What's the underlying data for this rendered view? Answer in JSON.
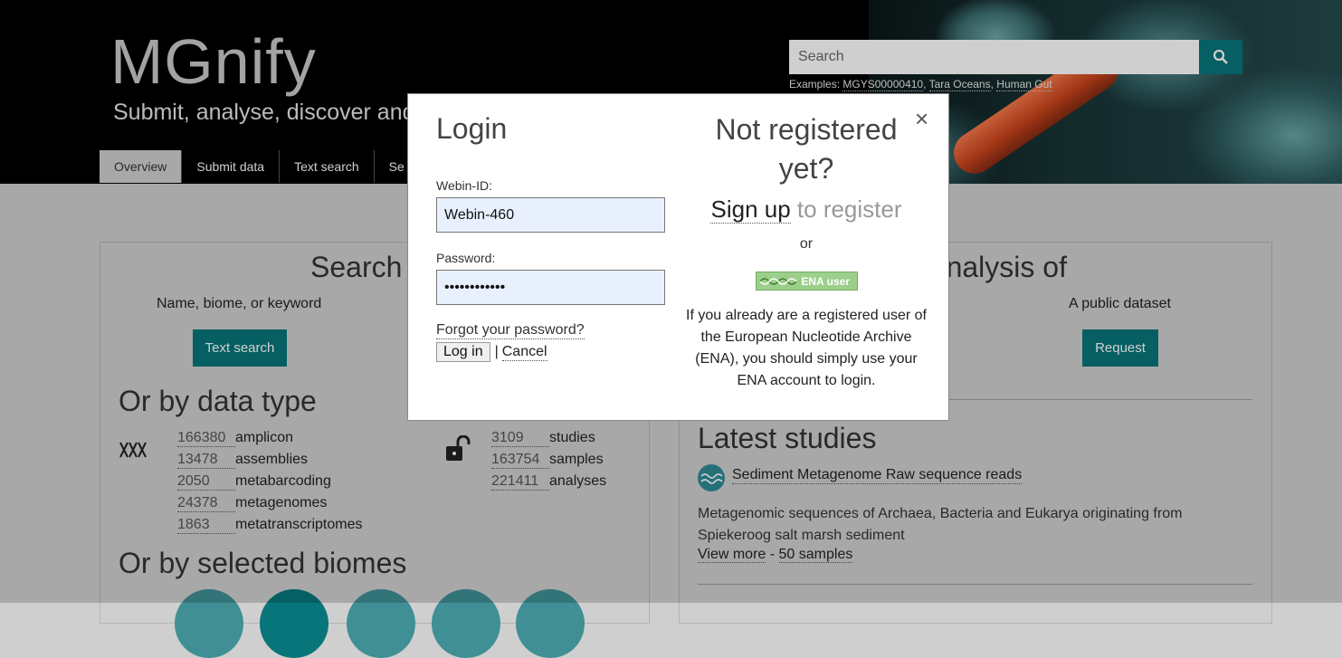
{
  "header": {
    "logo_text": "MGnify",
    "tagline": "Submit, analyse, discover and",
    "search_placeholder": "Search",
    "examples_label": "Examples:",
    "examples": [
      "MGYS00000410",
      "Tara Oceans",
      "Human Gut"
    ],
    "nav": [
      "Overview",
      "Submit data",
      "Text search",
      "Se"
    ]
  },
  "left_panel": {
    "search_heading": "Search",
    "search_sub": "Name, biome, or keyword",
    "text_search_btn": "Text search",
    "by_type_heading": "Or by data type",
    "types": [
      {
        "count": "166380",
        "label": "amplicon"
      },
      {
        "count": "13478",
        "label": "assemblies"
      },
      {
        "count": "2050",
        "label": "metabarcoding"
      },
      {
        "count": "24378",
        "label": "metagenomes"
      },
      {
        "count": "1863",
        "label": "metatranscriptomes"
      }
    ],
    "public": [
      {
        "count": "3109",
        "label": "studies"
      },
      {
        "count": "163754",
        "label": "samples"
      },
      {
        "count": "221411",
        "label": "analyses"
      }
    ],
    "biomes_heading": "Or by selected biomes"
  },
  "right_panel": {
    "request_heading": "t analysis of",
    "public_dataset": "A public dataset",
    "request_btn": "Request",
    "latest_heading": "Latest studies",
    "study": {
      "title": "Sediment Metagenome Raw sequence reads",
      "desc_line1": "Metagenomic sequences of Archaea, Bacteria and Eukarya originating from",
      "desc_line2": "Spiekeroog salt marsh sediment",
      "view_more": "View more",
      "sep": " - ",
      "samples": "50 samples"
    }
  },
  "modal": {
    "title": "Login",
    "webin_label": "Webin-ID:",
    "webin_value": "Webin-460",
    "password_label": "Password:",
    "password_value": "••••••••••••",
    "forgot": "Forgot your password?",
    "login_btn": "Log in",
    "sep": "|",
    "cancel": "Cancel",
    "close": "×",
    "not_registered": "Not registered yet?",
    "signup": "Sign up",
    "to_register": "to register",
    "or": "or",
    "ena_badge": "ENA user",
    "ena_info": "If you already are a registered user of the European Nucleotide Archive (ENA), you should simply use your ENA account to login."
  },
  "colors": {
    "teal": "#08757a",
    "badge": "#9ccf8a"
  }
}
